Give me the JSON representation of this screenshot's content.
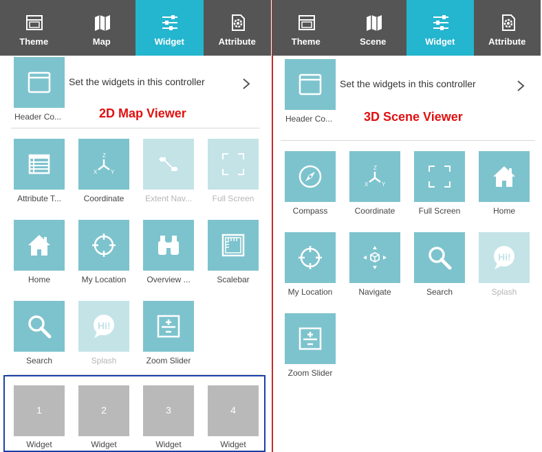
{
  "left": {
    "tabs": [
      {
        "label": "Theme",
        "icon": "theme-icon",
        "active": false
      },
      {
        "label": "Map",
        "icon": "map-icon",
        "active": false
      },
      {
        "label": "Widget",
        "icon": "widget-icon",
        "active": true
      },
      {
        "label": "Attribute",
        "icon": "attribute-icon",
        "active": false
      }
    ],
    "header_controller": {
      "label": "Header Co...",
      "text": "Set the widgets in this controller"
    },
    "viewer_title": "2D Map Viewer",
    "widgets": [
      {
        "label": "Attribute T...",
        "icon": "attribute-table-icon",
        "enabled": true
      },
      {
        "label": "Coordinate",
        "icon": "coordinate-icon",
        "enabled": true
      },
      {
        "label": "Extent Nav...",
        "icon": "extent-navigate-icon",
        "enabled": false
      },
      {
        "label": "Full Screen",
        "icon": "full-screen-icon",
        "enabled": false
      },
      {
        "label": "Home",
        "icon": "home-icon",
        "enabled": true
      },
      {
        "label": "My Location",
        "icon": "my-location-icon",
        "enabled": true
      },
      {
        "label": "Overview ...",
        "icon": "binoculars-icon",
        "enabled": true
      },
      {
        "label": "Scalebar",
        "icon": "scalebar-icon",
        "enabled": true
      },
      {
        "label": "Search",
        "icon": "search-icon",
        "enabled": true
      },
      {
        "label": "Splash",
        "icon": "splash-icon",
        "enabled": false
      },
      {
        "label": "Zoom Slider",
        "icon": "zoom-slider-icon",
        "enabled": true
      }
    ],
    "placeholders": [
      {
        "number": "1",
        "label": "Widget"
      },
      {
        "number": "2",
        "label": "Widget"
      },
      {
        "number": "3",
        "label": "Widget"
      },
      {
        "number": "4",
        "label": "Widget"
      }
    ]
  },
  "right": {
    "tabs": [
      {
        "label": "Theme",
        "icon": "theme-icon",
        "active": false
      },
      {
        "label": "Scene",
        "icon": "map-icon",
        "active": false
      },
      {
        "label": "Widget",
        "icon": "widget-icon",
        "active": true
      },
      {
        "label": "Attribute",
        "icon": "attribute-icon",
        "active": false
      }
    ],
    "header_controller": {
      "label": "Header Co...",
      "text": "Set the widgets in this controller"
    },
    "viewer_title": "3D Scene Viewer",
    "widgets": [
      {
        "label": "Compass",
        "icon": "compass-icon",
        "enabled": true
      },
      {
        "label": "Coordinate",
        "icon": "coordinate-icon",
        "enabled": true
      },
      {
        "label": "Full Screen",
        "icon": "full-screen-icon",
        "enabled": true
      },
      {
        "label": "Home",
        "icon": "home-icon",
        "enabled": true
      },
      {
        "label": "My Location",
        "icon": "my-location-icon",
        "enabled": true
      },
      {
        "label": "Navigate",
        "icon": "navigate-icon",
        "enabled": true
      },
      {
        "label": "Search",
        "icon": "search-icon",
        "enabled": true
      },
      {
        "label": "Splash",
        "icon": "splash-icon",
        "enabled": false
      },
      {
        "label": "Zoom Slider",
        "icon": "zoom-slider-icon",
        "enabled": true
      }
    ]
  }
}
